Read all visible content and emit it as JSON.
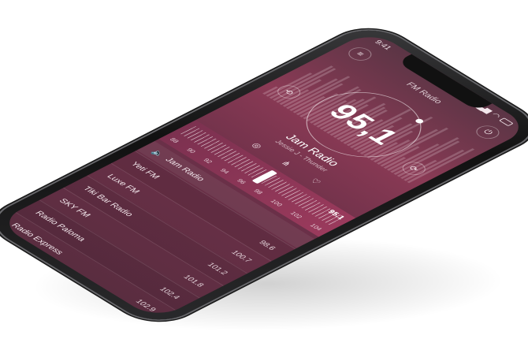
{
  "status": {
    "time": "9:41"
  },
  "app": {
    "title": "FM Radio"
  },
  "dial": {
    "frequency": "95,1"
  },
  "station": {
    "name": "Jam Radio",
    "subtitle": "Jessie J - Thunder"
  },
  "tuner": {
    "current": "95.1",
    "scale": [
      "88",
      "90",
      "92",
      "94",
      "96",
      "98",
      "100",
      "102",
      "104"
    ]
  },
  "now_playing": {
    "label": "Jam Radio"
  },
  "stations": [
    {
      "name": "Yeti FM",
      "freq": "98.6"
    },
    {
      "name": "Luxe FM",
      "freq": "100.7"
    },
    {
      "name": "Tiki Bar Radio",
      "freq": "101.2"
    },
    {
      "name": "SKY FM",
      "freq": "101.8"
    },
    {
      "name": "Radio Paloma",
      "freq": "102.4"
    },
    {
      "name": "Radio Express",
      "freq": "102.9"
    }
  ]
}
